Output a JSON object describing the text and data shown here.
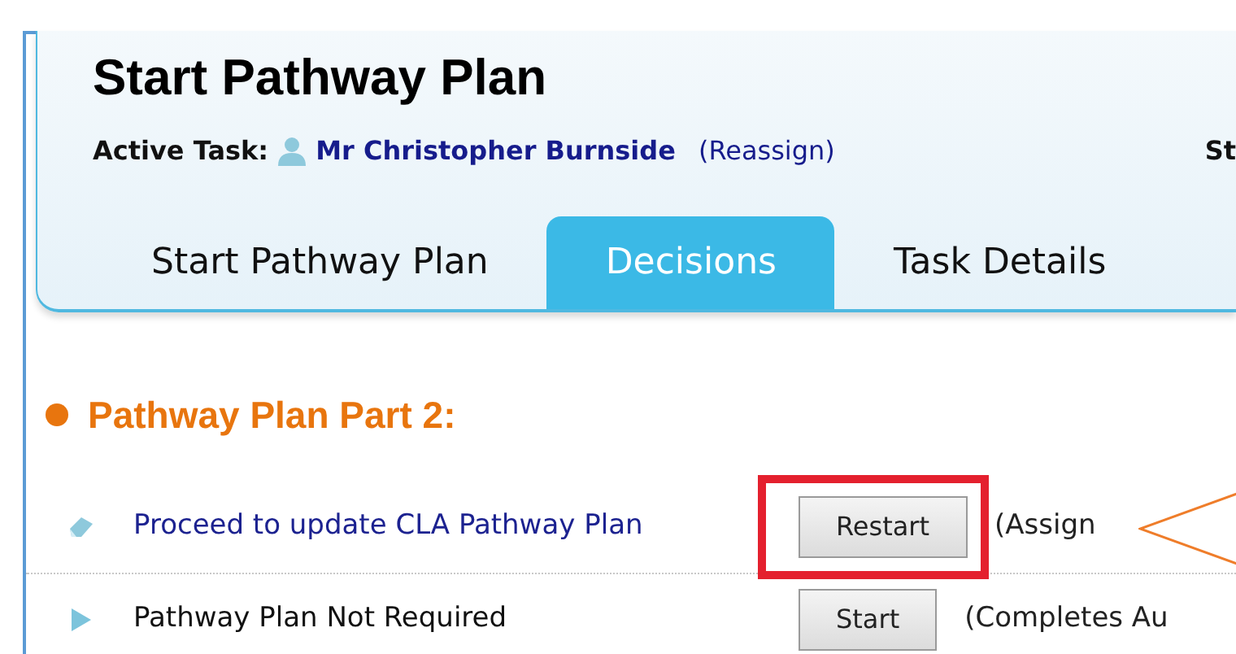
{
  "header": {
    "title": "Start Pathway Plan",
    "active_task_label": "Active Task:",
    "assignee": "Mr Christopher Burnside",
    "reassign_link": "(Reassign)",
    "cut_label": "St"
  },
  "tabs": [
    {
      "label": "Start Pathway Plan",
      "selected": false
    },
    {
      "label": "Decisions",
      "selected": true
    },
    {
      "label": "Task Details",
      "selected": false
    }
  ],
  "section": {
    "title": "Pathway Plan Part 2:"
  },
  "decisions": [
    {
      "kind": "in-progress",
      "label": "Proceed to update CLA Pathway Plan",
      "button": "Restart",
      "note": "(Assign",
      "highlighted": true
    },
    {
      "kind": "available",
      "label": "Pathway Plan Not Required",
      "button": "Start",
      "note": "(Completes Au",
      "highlighted": false
    }
  ]
}
